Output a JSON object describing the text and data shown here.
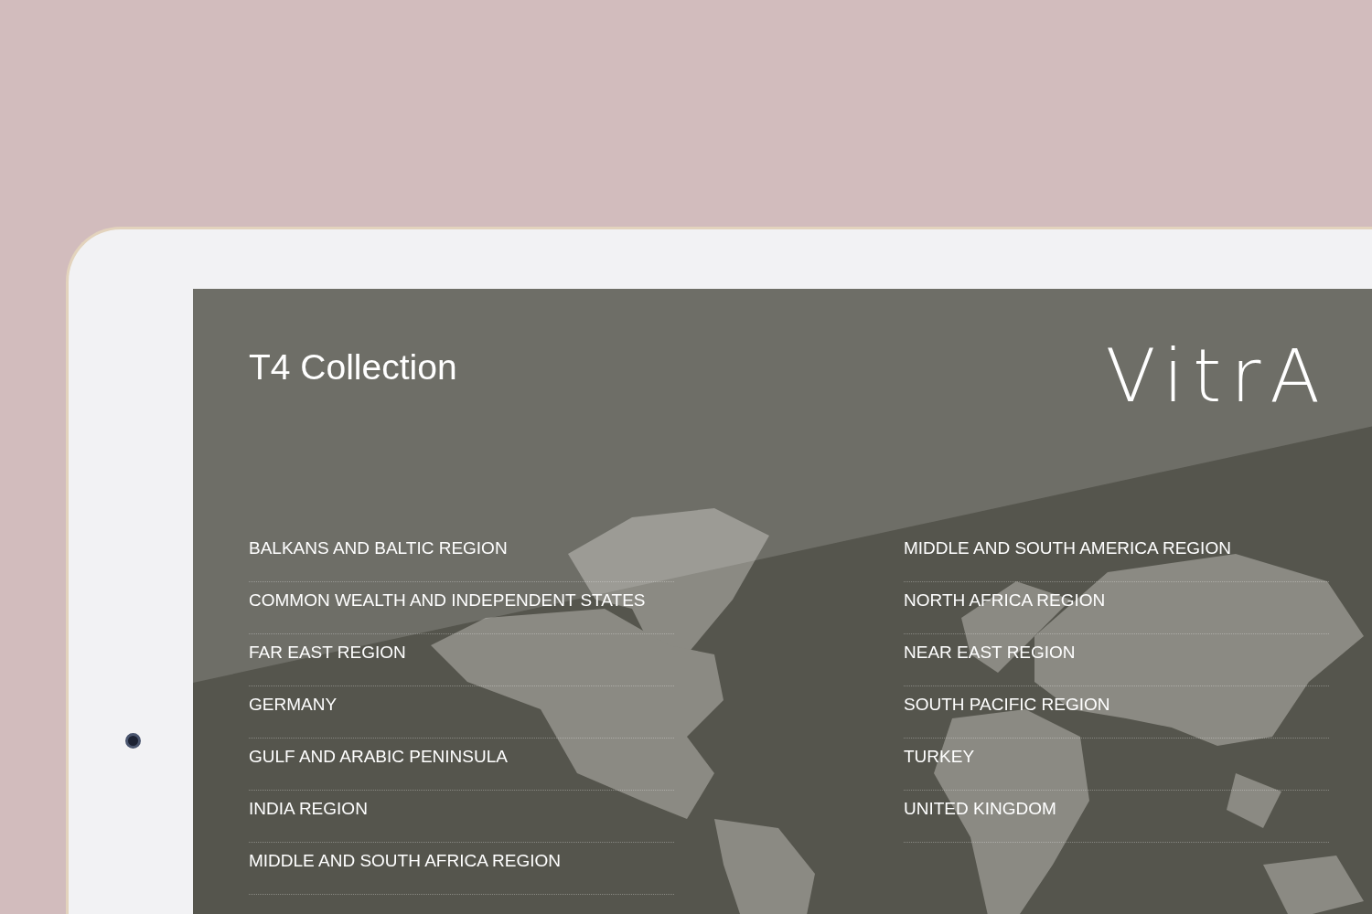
{
  "screen": {
    "title": "T4 Collection",
    "logo": "VitrA",
    "regions_left": [
      {
        "label": "BALKANS AND BALTIC REGION"
      },
      {
        "label": "COMMON WEALTH AND INDEPENDENT STATES"
      },
      {
        "label": "FAR EAST REGION"
      },
      {
        "label": "GERMANY"
      },
      {
        "label": "GULF AND ARABIC PENINSULA"
      },
      {
        "label": "INDIA REGION"
      },
      {
        "label": "MIDDLE AND SOUTH AFRICA REGION"
      }
    ],
    "regions_right": [
      {
        "label": "MIDDLE AND SOUTH AMERICA REGION"
      },
      {
        "label": "NORTH AFRICA REGION"
      },
      {
        "label": "NEAR EAST REGION"
      },
      {
        "label": "SOUTH PACIFIC REGION"
      },
      {
        "label": "TURKEY"
      },
      {
        "label": "UNITED KINGDOM"
      }
    ]
  }
}
